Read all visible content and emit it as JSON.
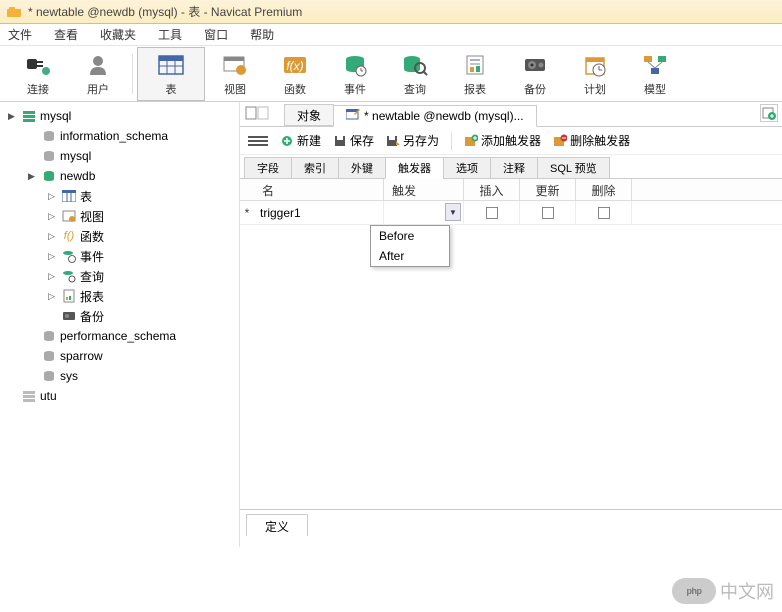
{
  "title": "* newtable @newdb (mysql) - 表 - Navicat Premium",
  "menu": [
    "文件",
    "查看",
    "收藏夹",
    "工具",
    "窗口",
    "帮助"
  ],
  "toolbar": [
    {
      "label": "连接",
      "icon": "plug"
    },
    {
      "label": "用户",
      "icon": "user"
    },
    {
      "label": "表",
      "icon": "table",
      "selected": true
    },
    {
      "label": "视图",
      "icon": "view"
    },
    {
      "label": "函数",
      "icon": "fx"
    },
    {
      "label": "事件",
      "icon": "event"
    },
    {
      "label": "查询",
      "icon": "query"
    },
    {
      "label": "报表",
      "icon": "report"
    },
    {
      "label": "备份",
      "icon": "backup"
    },
    {
      "label": "计划",
      "icon": "schedule"
    },
    {
      "label": "模型",
      "icon": "model"
    }
  ],
  "tree": [
    {
      "label": "mysql",
      "level": 1,
      "arrow": "▶",
      "icon": "db-green"
    },
    {
      "label": "information_schema",
      "level": 2,
      "arrow": "",
      "icon": "db"
    },
    {
      "label": "mysql",
      "level": 2,
      "arrow": "",
      "icon": "db"
    },
    {
      "label": "newdb",
      "level": 2,
      "arrow": "▶",
      "icon": "db-green"
    },
    {
      "label": "表",
      "level": 3,
      "arrow": "▷",
      "icon": "table"
    },
    {
      "label": "视图",
      "level": 3,
      "arrow": "▷",
      "icon": "view"
    },
    {
      "label": "函数",
      "level": 3,
      "arrow": "▷",
      "icon": "fx"
    },
    {
      "label": "事件",
      "level": 3,
      "arrow": "▷",
      "icon": "event"
    },
    {
      "label": "查询",
      "level": 3,
      "arrow": "▷",
      "icon": "query"
    },
    {
      "label": "报表",
      "level": 3,
      "arrow": "▷",
      "icon": "report"
    },
    {
      "label": "备份",
      "level": 3,
      "arrow": "",
      "icon": "backup"
    },
    {
      "label": "performance_schema",
      "level": 2,
      "arrow": "",
      "icon": "db"
    },
    {
      "label": "sparrow",
      "level": 2,
      "arrow": "",
      "icon": "db"
    },
    {
      "label": "sys",
      "level": 2,
      "arrow": "",
      "icon": "db"
    },
    {
      "label": "utu",
      "level": 1,
      "arrow": "",
      "icon": "db-gray"
    }
  ],
  "content_tabs": [
    {
      "label": "对象",
      "active": false
    },
    {
      "label": "* newtable @newdb (mysql)...",
      "active": true,
      "icon": "table-edit"
    }
  ],
  "ctoolbar": {
    "new": "新建",
    "save": "保存",
    "saveas": "另存为",
    "add_trigger": "添加触发器",
    "del_trigger": "删除触发器"
  },
  "sub_tabs": [
    "字段",
    "索引",
    "外键",
    "触发器",
    "选项",
    "注释",
    "SQL 预览"
  ],
  "active_sub_tab": 3,
  "table": {
    "headers": {
      "name": "名",
      "trigger": "触发",
      "insert": "插入",
      "update": "更新",
      "delete": "删除"
    },
    "rows": [
      {
        "marker": "*",
        "name": "trigger1",
        "trigger": "",
        "insert": false,
        "update": false,
        "delete": false
      }
    ],
    "dropdown_options": [
      "Before",
      "After"
    ]
  },
  "def_tab": "定义",
  "watermark": {
    "badge": "php",
    "text": "中文网"
  }
}
